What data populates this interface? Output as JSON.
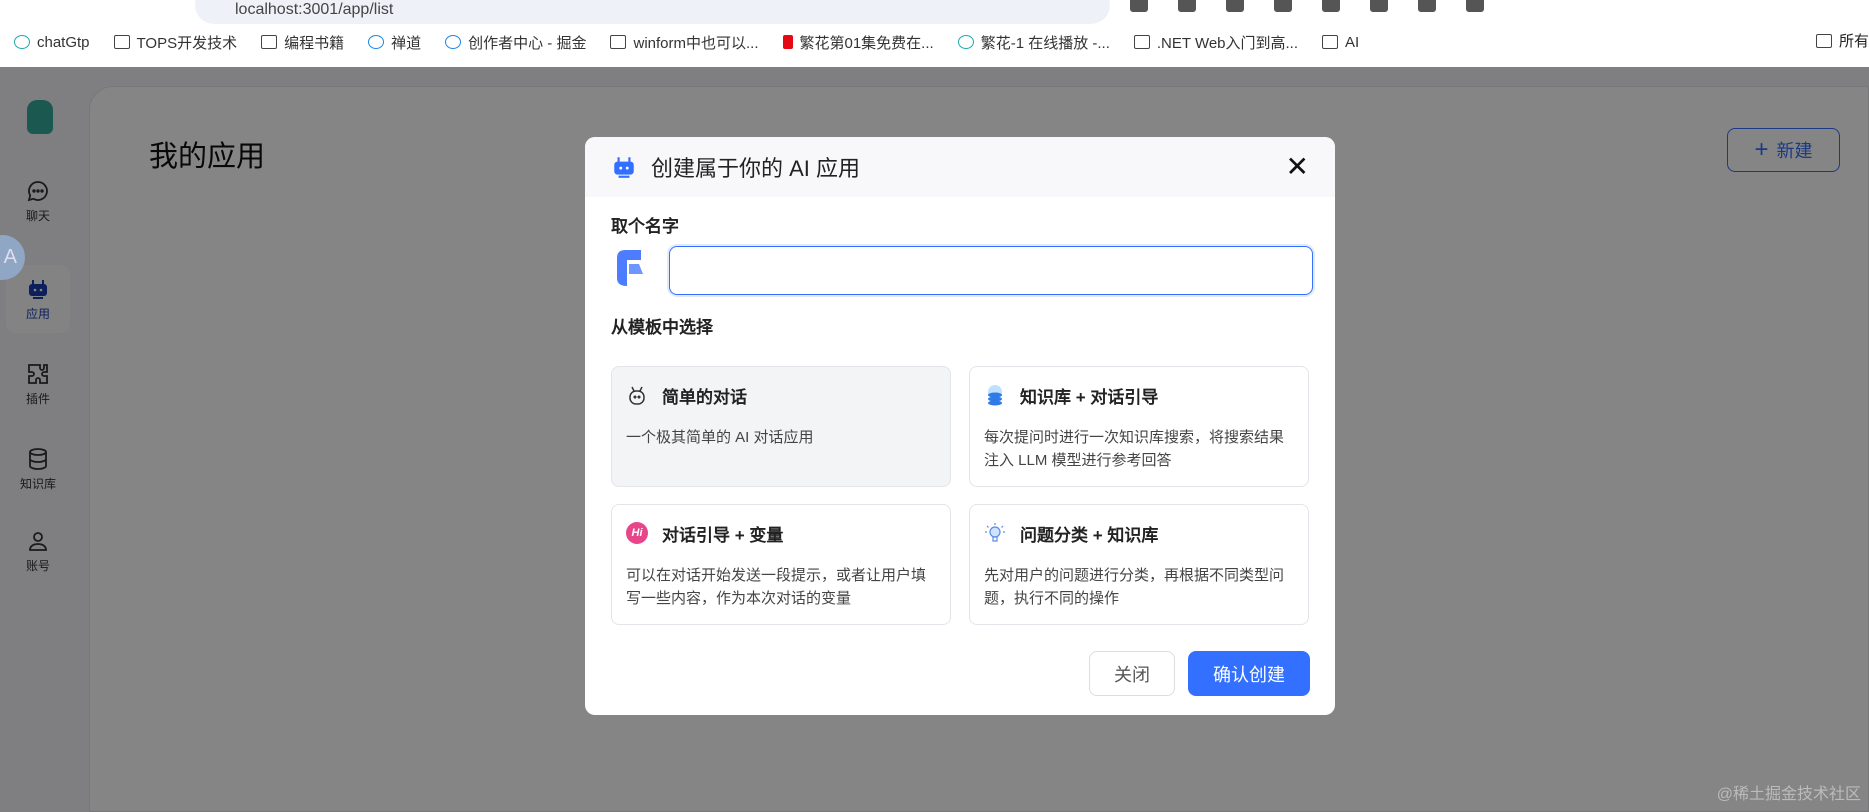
{
  "browser": {
    "url": "localhost:3001/app/list",
    "bookmarks": [
      "chatGtp",
      "TOPS开发技术",
      "编程书籍",
      "禅道",
      "创作者中心 - 掘金",
      "winform中也可以...",
      "繁花第01集免费在...",
      "繁花-1 在线播放 -...",
      ".NET Web入门到高...",
      "AI"
    ],
    "bookmarks_right": "所有"
  },
  "sidebar": {
    "items": [
      {
        "label": "聊天",
        "icon": "chat-icon"
      },
      {
        "label": "应用",
        "icon": "robot-icon",
        "active": true
      },
      {
        "label": "插件",
        "icon": "puzzle-icon"
      },
      {
        "label": "知识库",
        "icon": "database-icon"
      },
      {
        "label": "账号",
        "icon": "user-icon"
      }
    ]
  },
  "main": {
    "title": "我的应用",
    "new_button": "新建"
  },
  "modal": {
    "title": "创建属于你的 AI 应用",
    "name_label": "取个名字",
    "name_value": "",
    "template_label": "从模板中选择",
    "templates": [
      {
        "title": "简单的对话",
        "desc": "一个极其简单的 AI 对话应用",
        "selected": true
      },
      {
        "title": "知识库 + 对话引导",
        "desc": "每次提问时进行一次知识库搜索，将搜索结果注入 LLM 模型进行参考回答"
      },
      {
        "title": "对话引导 + 变量",
        "desc": "可以在对话开始发送一段提示，或者让用户填写一些内容，作为本次对话的变量",
        "badge": "Hi"
      },
      {
        "title": "问题分类 + 知识库",
        "desc": "先对用户的问题进行分类，再根据不同类型问题，执行不同的操作"
      }
    ],
    "cancel": "关闭",
    "confirm": "确认创建"
  },
  "translate_badge": "A",
  "watermark": "@稀土掘金技术社区",
  "colors": {
    "accent": "#3370ff",
    "overlay": "rgba(0,0,0,0.48)"
  }
}
